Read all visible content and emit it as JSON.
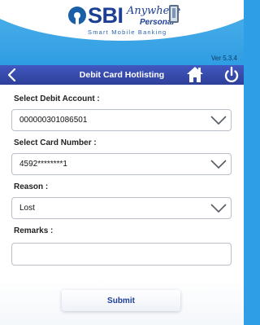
{
  "branding": {
    "logo_sbi": "SBI",
    "logo_anywhere": "Anywhere",
    "logo_personal": "Personal",
    "logo_tagline": "Smart Mobile Banking",
    "version": "Ver 5.3.4"
  },
  "toolbar": {
    "title": "Debit Card Hotlisting",
    "back_icon": "back-chevron-icon",
    "home_icon": "home-icon",
    "power_icon": "power-icon"
  },
  "form": {
    "debit_account": {
      "label": "Select Debit Account :",
      "value": "000000301086501"
    },
    "card_number": {
      "label": "Select Card Number :",
      "value": "4592********1"
    },
    "reason": {
      "label": "Reason :",
      "value": "Lost"
    },
    "remarks": {
      "label": "Remarks :",
      "value": "",
      "placeholder": ""
    },
    "submit_label": "Submit"
  },
  "colors": {
    "header_blue": "#2f9de3",
    "toolbar_blue": "#3a4fb0",
    "brand_navy": "#1c3f95"
  }
}
